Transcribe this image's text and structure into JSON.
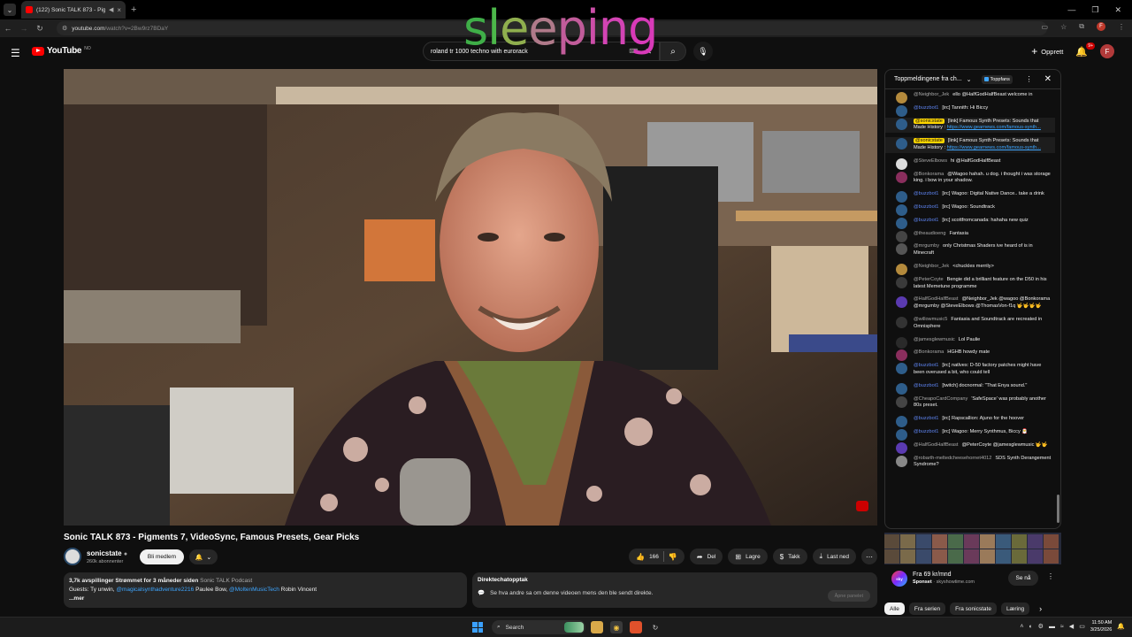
{
  "browser": {
    "tab_title": "(122) Sonic TALK 873 - Pigm",
    "url_host": "youtube.com",
    "url_path": "/watch?v=2Bw9rz7BDaY"
  },
  "youtube": {
    "logo_text": "YouTube",
    "logo_region": "NO",
    "search_value": "roland tr 1000 techno with eurorack",
    "create_label": "Opprett",
    "notif_count": "9+",
    "avatar_letter": "F"
  },
  "overlay_word": {
    "text": "sleeping",
    "colors": [
      "#3fae48",
      "#4cb84a",
      "#8fae4e",
      "#b07a8a",
      "#c15c9a",
      "#cc4ea8",
      "#d344b4",
      "#d83ab8"
    ]
  },
  "video": {
    "title": "Sonic TALK 873 - Pigments 7, VideoSync, Famous Presets, Gear Picks",
    "channel": "sonicstate",
    "subscribers": "260k abonnenter",
    "join_label": "Bli medlem",
    "likes": "166",
    "share_label": "Del",
    "save_label": "Lagre",
    "thanks_label": "Takk",
    "download_label": "Last ned"
  },
  "description": {
    "views": "3,7k avspillinger",
    "streamed": "Strømmet for 3 måneder siden",
    "podcast": "Sonic TALK Podcast",
    "guests_prefix": "Guests: Ty unwin,",
    "guest_link1": "@magicalsynthadventure2216",
    "guest2": "Paulee Bow,",
    "guest_link2": "@MoltenMusicTech",
    "guest3": "Robin Vincent",
    "more": "...mer"
  },
  "replay": {
    "title": "Direktechatopptak",
    "text": "Se hva andre sa om denne videoen mens den ble sendt direkte.",
    "open_label": "Åpne panelet"
  },
  "chat": {
    "header": "Toppmeldingene fra ch...",
    "fans_label": "Toppfans",
    "messages": [
      {
        "author": "@Neighbor_Jek",
        "text": "ello @HalfGodHalfBeast welcome in",
        "type": "normal",
        "avatar": "#b48a3c"
      },
      {
        "author": "@buzzbot1",
        "text": "[irc] Tannith: Hi Biccy",
        "type": "mod",
        "avatar": "#2e5d8a"
      },
      {
        "author": "@sonicstate",
        "text": "[link] Famous Synth Presets: Sounds that Made History :",
        "link": "https://www.gearnews.com/famous-synth...",
        "type": "owner",
        "avatar": "#2e5d8a"
      },
      {
        "author": "@sonicstate",
        "text": "[link] Famous Synth Presets: Sounds that Made History :",
        "link": "https://www.gearnews.com/famous-synth...",
        "type": "owner",
        "avatar": "#2e5d8a"
      },
      {
        "author": "@SteveElbows",
        "text": "hi @HalfGodHalfBeast",
        "type": "normal",
        "avatar": "#dcdcdc"
      },
      {
        "author": "@Bonkorama",
        "text": "@Wagoo hahah. u dog. i thought i was storage king. i bow in your shadow.",
        "type": "normal-green",
        "avatar": "#8a2e5d"
      },
      {
        "author": "@buzzbot1",
        "text": "[irc] Wagoo: Digital Native Dance.. take a drink",
        "type": "mod",
        "avatar": "#2e5d8a"
      },
      {
        "author": "@buzzbot1",
        "text": "[irc] Wagoo: Soundtrack",
        "type": "mod",
        "avatar": "#2e5d8a"
      },
      {
        "author": "@buzzbot1",
        "text": "[irc] scottfromcanada: hahaha new quiz",
        "type": "mod",
        "avatar": "#2e5d8a"
      },
      {
        "author": "@theaudioeng",
        "text": "Fantasia",
        "type": "normal",
        "avatar": "#444444"
      },
      {
        "author": "@mrgumby",
        "text": "only Christmas Shaders ive heard of is in Minecraft",
        "type": "normal",
        "avatar": "#555555"
      },
      {
        "author": "@Neighbor_Jek",
        "text": "<chuckles merrily>",
        "type": "normal",
        "avatar": "#b48a3c"
      },
      {
        "author": "@PeterCoyte",
        "text": "Bengie did a brilliant feature on the D50 in his latest Memetune programme",
        "type": "normal",
        "avatar": "#3a3a3a"
      },
      {
        "author": "@HalfGodHalfBeast",
        "text": "@Neighbor_Jek @wagoo @Bonkorama @mrgumby @SteveElbows @ThomasVon-f1q 🤟🤟🤟🤟",
        "type": "normal",
        "avatar": "#5a3ab0"
      },
      {
        "author": "@willowmusic5",
        "text": "Fantasia and Soundtrack are recreated in Omnisphere",
        "type": "normal",
        "avatar": "#333333"
      },
      {
        "author": "@jamesglewmusic",
        "text": "Lol Paulie",
        "type": "normal",
        "avatar": "#2a2a2a"
      },
      {
        "author": "@Bonkorama",
        "text": "HGHB howdy mate",
        "type": "normal-green",
        "avatar": "#8a2e5d"
      },
      {
        "author": "@buzzbot1",
        "text": "[irc] natlves: D-50 factory patches might have been overused a bit, who could tell",
        "type": "mod",
        "avatar": "#2e5d8a"
      },
      {
        "author": "@buzzbot1",
        "text": "[twitch] docnormal: \"That Enya sound.\"",
        "type": "mod",
        "avatar": "#2e5d8a"
      },
      {
        "author": "@CheapoCardCompany",
        "text": "'SafeSpace' was probably another 80s preset.",
        "type": "normal",
        "avatar": "#444444"
      },
      {
        "author": "@buzzbot1",
        "text": "[irc] Rapscallion: Ajuno for the hoover",
        "type": "mod",
        "avatar": "#2e5d8a"
      },
      {
        "author": "@buzzbot1",
        "text": "[irc] Wagoo: Merry Synthmus, Biccy 🎅",
        "type": "mod",
        "avatar": "#2e5d8a"
      },
      {
        "author": "@HalfGodHalfBeast",
        "text": "@PeterCoyte @jamesglewmusic 🤟🤟",
        "type": "normal",
        "avatar": "#5a3ab0"
      },
      {
        "author": "@robarth-meltedcheesehornet4012",
        "text": "SDS Synth Derangement Syndrome?",
        "type": "normal",
        "avatar": "#888888"
      }
    ]
  },
  "ad": {
    "logo_text": "sky",
    "price": "Fra 69 kr/mnd",
    "sponsor_label": "Sponset",
    "sponsor_domain": "skyshowtime.com",
    "cta": "Se nå"
  },
  "chips": [
    "Alle",
    "Fra serien",
    "Fra sonicstate",
    "Læring"
  ],
  "taskbar": {
    "search_label": "Search",
    "time": "11:50 AM",
    "date": "3/25/2026"
  }
}
